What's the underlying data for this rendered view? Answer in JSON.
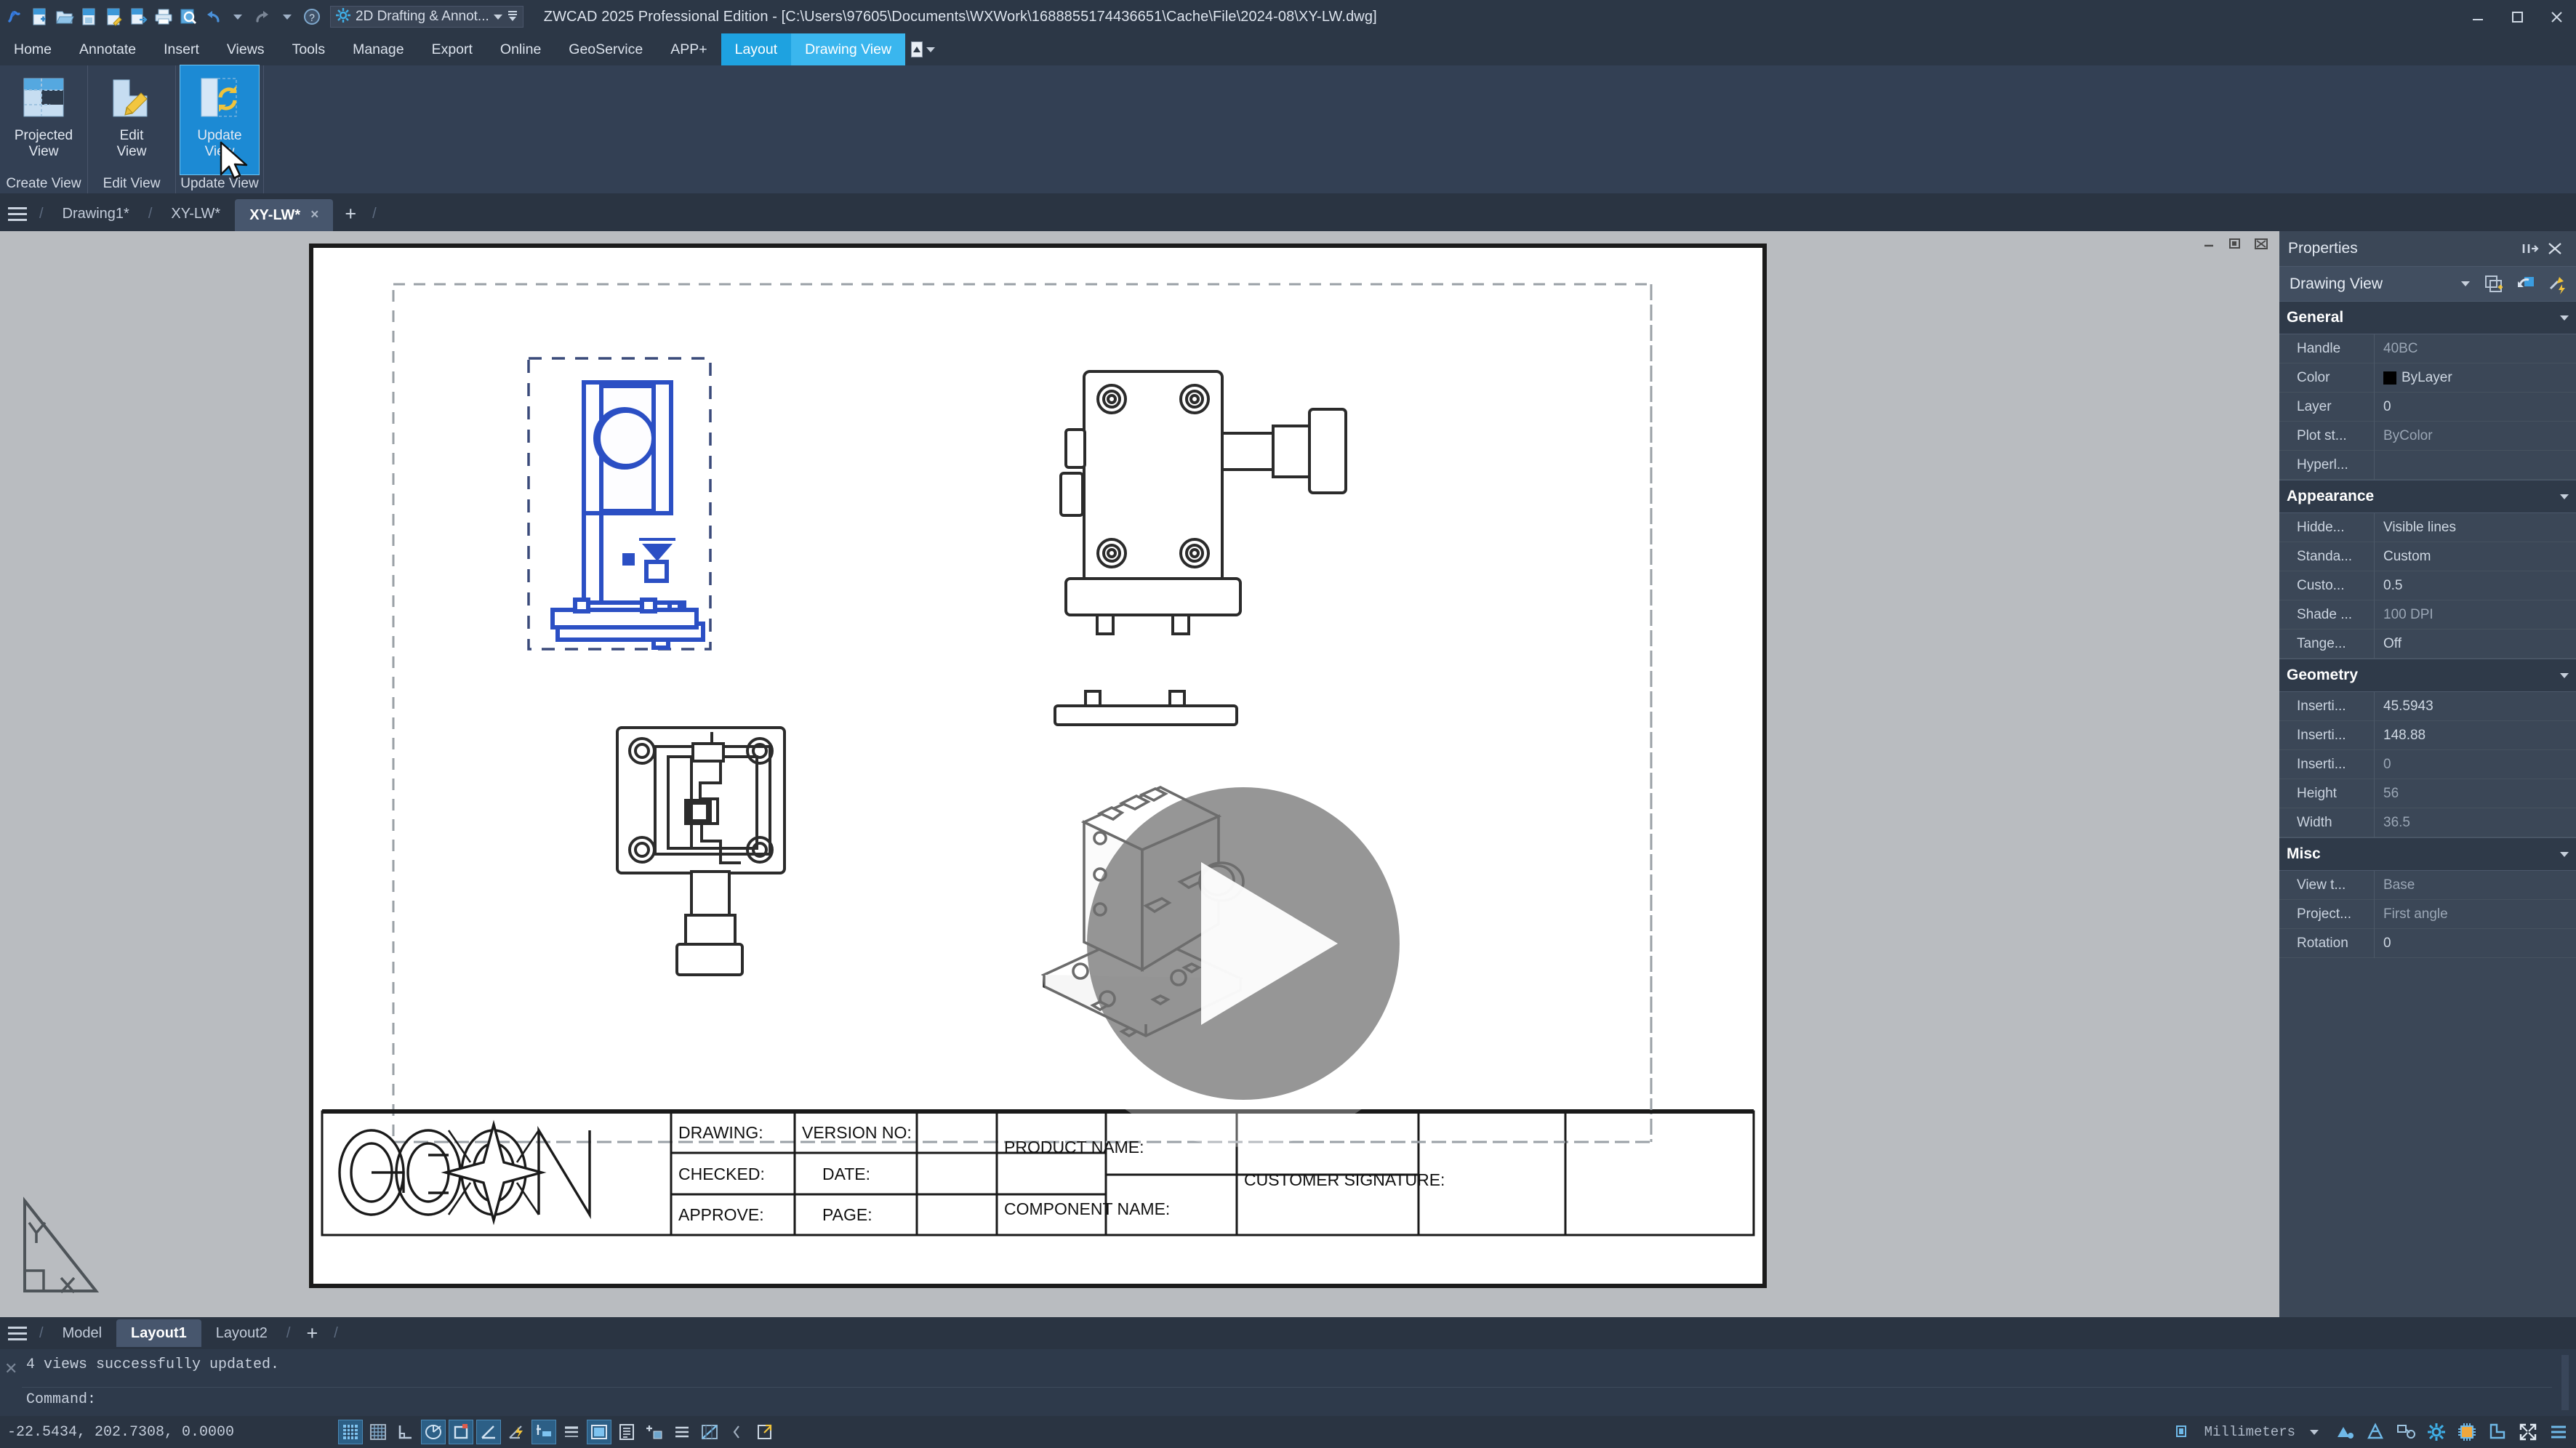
{
  "window": {
    "title": "ZWCAD 2025 Professional Edition - [C:\\Users\\97605\\Documents\\WXWork\\1688855174436651\\Cache\\File\\2024-08\\XY-LW.dwg]",
    "workspace": "2D Drafting & Annot...",
    "quick_access_icons": [
      "zwcad-logo-icon",
      "new-icon",
      "open-icon",
      "save-icon",
      "save-as-icon",
      "export-icon",
      "print-icon",
      "preview-icon",
      "undo-icon",
      "redo-icon",
      "help-icon"
    ],
    "controls": [
      "minimize-icon",
      "maximize-icon",
      "close-icon"
    ]
  },
  "menu": {
    "items": [
      {
        "label": "Home",
        "state": "normal"
      },
      {
        "label": "Annotate",
        "state": "normal"
      },
      {
        "label": "Insert",
        "state": "normal"
      },
      {
        "label": "Views",
        "state": "normal"
      },
      {
        "label": "Tools",
        "state": "normal"
      },
      {
        "label": "Manage",
        "state": "normal"
      },
      {
        "label": "Export",
        "state": "normal"
      },
      {
        "label": "Online",
        "state": "normal"
      },
      {
        "label": "GeoService",
        "state": "normal"
      },
      {
        "label": "APP+",
        "state": "normal"
      },
      {
        "label": "Layout",
        "state": "highlight-dark"
      },
      {
        "label": "Drawing View",
        "state": "highlight-light"
      }
    ]
  },
  "ribbon": {
    "groups": [
      {
        "title": "Create View",
        "button": {
          "label_line1": "Projected",
          "label_line2": "View",
          "icon": "projected-view-icon",
          "selected": false
        }
      },
      {
        "title": "Edit View",
        "button": {
          "label_line1": "Edit",
          "label_line2": "View",
          "icon": "edit-view-icon",
          "selected": false
        }
      },
      {
        "title": "Update View",
        "button": {
          "label_line1": "Update",
          "label_line2": "View",
          "icon": "update-view-icon",
          "selected": true
        }
      }
    ]
  },
  "file_tabs": {
    "tabs": [
      {
        "label": "Drawing1*",
        "active": false,
        "closable": false
      },
      {
        "label": "XY-LW*",
        "active": false,
        "closable": false
      },
      {
        "label": "XY-LW*",
        "active": true,
        "closable": true,
        "close_glyph": "×"
      }
    ],
    "new_tab_glyph": "+"
  },
  "drawing": {
    "title_block": {
      "logo_text": "GCON",
      "fields": [
        {
          "label": "DRAWING:",
          "value": ""
        },
        {
          "label": "VERSION NO:",
          "value": ""
        },
        {
          "label": "CHECKED:",
          "value": ""
        },
        {
          "label": "DATE:",
          "value": ""
        },
        {
          "label": "APPROVE:",
          "value": ""
        },
        {
          "label": "PAGE:",
          "value": ""
        },
        {
          "label": "PRODUCT NAME:",
          "value": ""
        },
        {
          "label": "COMPONENT NAME:",
          "value": ""
        },
        {
          "label": "CUSTOMER SIGNATURE:",
          "value": ""
        }
      ]
    },
    "views": [
      {
        "name": "front-view",
        "selected": true,
        "color": "#2b4fc4"
      },
      {
        "name": "side-view",
        "selected": false,
        "color": "#333333"
      },
      {
        "name": "top-view",
        "selected": false,
        "color": "#333333"
      },
      {
        "name": "isometric-view",
        "selected": false,
        "color": "#333333"
      }
    ],
    "video_overlay": {
      "visible": true,
      "icon": "play-button-icon"
    },
    "ucs_icon": {
      "x_label": "X",
      "y_label": "Y"
    }
  },
  "properties": {
    "panel_title": "Properties",
    "header_icons": [
      "pin-icon",
      "close-icon"
    ],
    "object_type": "Drawing View",
    "toolbar_icons": [
      "quick-select-icon",
      "refresh-icon",
      "pickadd-icon"
    ],
    "sections": [
      {
        "name": "General",
        "rows": [
          {
            "key": "Handle",
            "value": "40BC",
            "dim": true
          },
          {
            "key": "Color",
            "value": "ByLayer",
            "dim": false,
            "swatch": "#000000"
          },
          {
            "key": "Layer",
            "value": "0",
            "dim": false
          },
          {
            "key": "Plot st...",
            "value": "ByColor",
            "dim": true
          },
          {
            "key": "Hyperl...",
            "value": "",
            "dim": false
          }
        ]
      },
      {
        "name": "Appearance",
        "rows": [
          {
            "key": "Hidde...",
            "value": "Visible lines",
            "dim": false
          },
          {
            "key": "Standa...",
            "value": "Custom",
            "dim": false
          },
          {
            "key": "Custo...",
            "value": "0.5",
            "dim": false
          },
          {
            "key": "Shade ...",
            "value": "100  DPI",
            "dim": true
          },
          {
            "key": "Tange...",
            "value": "Off",
            "dim": false
          }
        ]
      },
      {
        "name": "Geometry",
        "rows": [
          {
            "key": "Inserti...",
            "value": "45.5943",
            "dim": false
          },
          {
            "key": "Inserti...",
            "value": "148.88",
            "dim": false
          },
          {
            "key": "Inserti...",
            "value": "0",
            "dim": true
          },
          {
            "key": "Height",
            "value": "56",
            "dim": true
          },
          {
            "key": "Width",
            "value": "36.5",
            "dim": true
          }
        ]
      },
      {
        "name": "Misc",
        "rows": [
          {
            "key": "View t...",
            "value": "Base",
            "dim": true
          },
          {
            "key": "Project...",
            "value": "First angle",
            "dim": true
          },
          {
            "key": "Rotation",
            "value": "0",
            "dim": false
          }
        ]
      }
    ]
  },
  "layout_tabs": {
    "tabs": [
      {
        "label": "Model",
        "active": false
      },
      {
        "label": "Layout1",
        "active": true
      },
      {
        "label": "Layout2",
        "active": false
      }
    ],
    "new_tab_glyph": "+"
  },
  "command_line": {
    "history": "4 views successfully updated.",
    "prompt": "Command:",
    "input_value": ""
  },
  "status_bar": {
    "coordinates": "-22.5434,  202.7308,  0.0000",
    "left_icons": [
      "snap-icon",
      "grid-icon",
      "ortho-icon",
      "polar-tracking-icon",
      "object-snap-icon",
      "angle-snap-icon",
      "otrack-icon",
      "dynamic-ucs-icon",
      "lineweight-icon",
      "model-space-icon",
      "quick-properties-icon",
      "selection-cycling-icon",
      "annotation-scale-icon",
      "transparency-icon"
    ],
    "units": "Millimeters",
    "right_icons": [
      "annotation-visibility-icon",
      "auto-scale-icon",
      "workspace-icon",
      "settings-gear-icon",
      "hardware-accel-icon",
      "isolate-objects-icon",
      "fullscreen-icon",
      "customization-menu-icon"
    ]
  },
  "colors": {
    "accent": "#1ea2e0",
    "accent_light": "#3ab6ee",
    "chrome": "#2c3746",
    "panel": "#3b4757",
    "canvas": "#b9bcc0",
    "selection_blue": "#2b4fc4"
  }
}
